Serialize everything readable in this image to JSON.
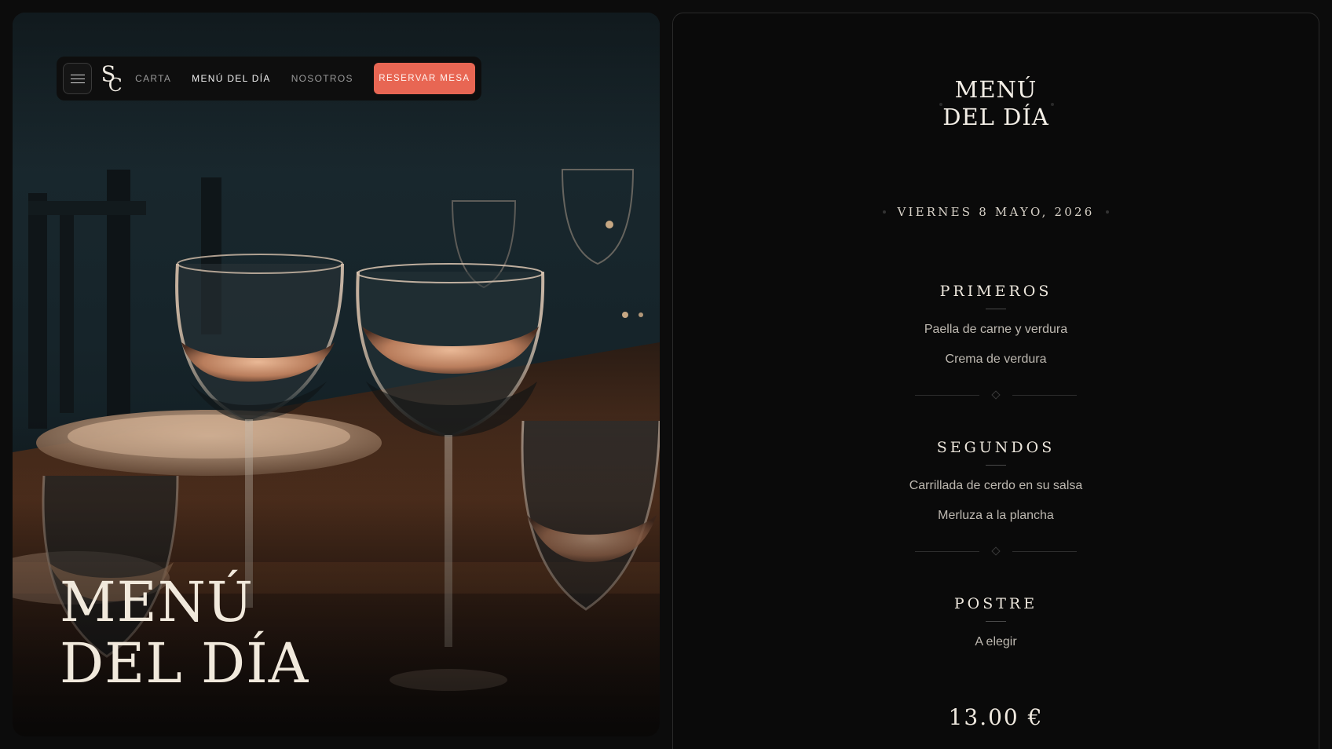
{
  "nav": {
    "menu_icon": "hamburger-icon",
    "logo_letters": "SC",
    "links": [
      {
        "label": "CARTA",
        "active": false
      },
      {
        "label": "MENÚ DEL DÍA",
        "active": true
      },
      {
        "label": "NOSOTROS",
        "active": false
      }
    ],
    "cta_label": "RESERVAR MESA",
    "cta_color": "#e86653"
  },
  "hero": {
    "title_line1": "MENÚ",
    "title_line2": "DEL DÍA"
  },
  "panel": {
    "title_line1": "MENÚ",
    "title_line2": "DEL DÍA",
    "date": "VIERNES 8 MAYO, 2026",
    "courses": [
      {
        "title": "PRIMEROS",
        "dishes": [
          "Paella de carne y verdura",
          "Crema de verdura"
        ]
      },
      {
        "title": "SEGUNDOS",
        "dishes": [
          "Carrillada de cerdo en su salsa",
          "Merluza a la plancha"
        ]
      },
      {
        "title": "POSTRE",
        "dishes": [
          "A elegir"
        ]
      }
    ],
    "price": "13.00 €"
  },
  "colors": {
    "background": "#0c0c0c",
    "accent": "#e86653",
    "cream_text": "#f1e9dc"
  }
}
